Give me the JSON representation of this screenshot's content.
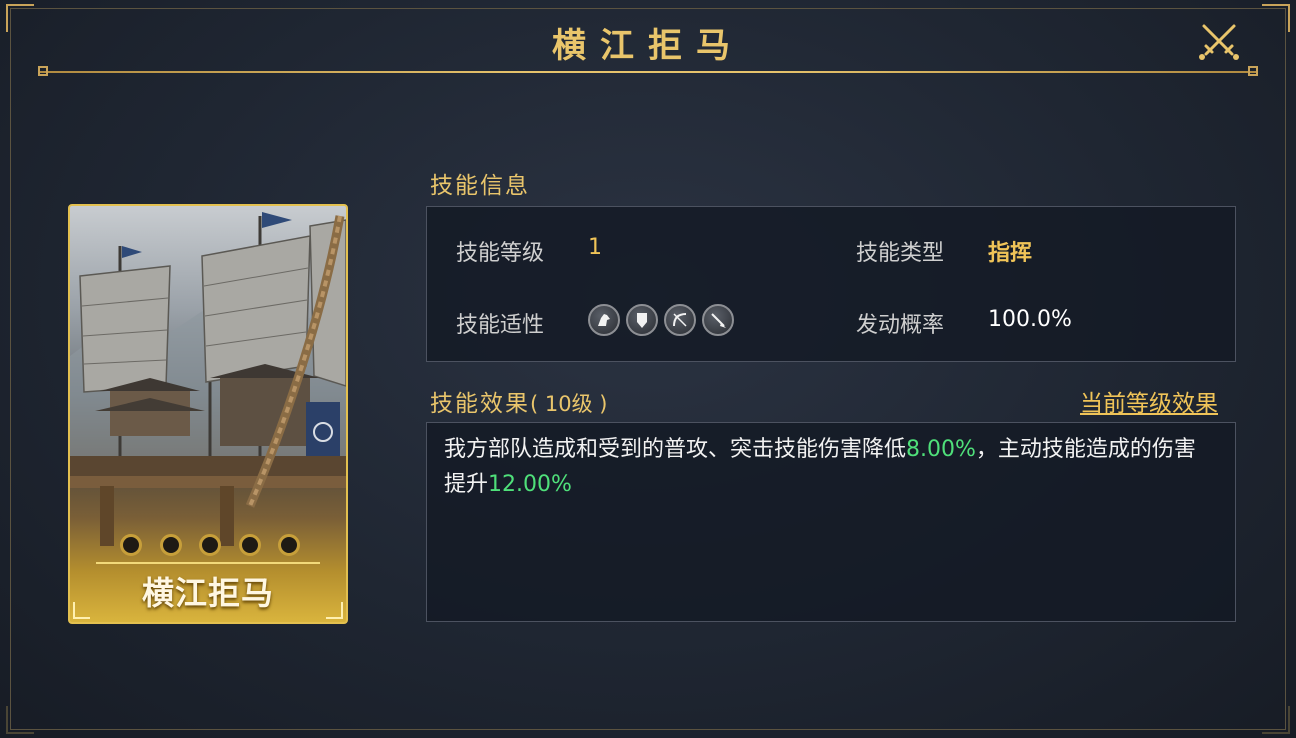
{
  "header": {
    "title": "横江拒马"
  },
  "card": {
    "name": "横江拒马"
  },
  "skill_info": {
    "section_title": "技能信息",
    "level_label": "技能等级",
    "level_value": "1",
    "type_label": "技能类型",
    "type_value": "指挥",
    "aptitude_label": "技能适性",
    "aptitude_icons": [
      "cavalry-icon",
      "shield-icon",
      "bow-icon",
      "spear-icon"
    ],
    "chance_label": "发动概率",
    "chance_value": "100.0%"
  },
  "skill_effect": {
    "section_title": "技能效果",
    "level_note": "( 10级 )",
    "current_level_link": "当前等级效果",
    "text_part1": "我方部队造成和受到的普攻、突击技能伤害降低",
    "value1": "8.00%",
    "text_part2": "，主动技能造成的伤害提升",
    "value2": "12.00%"
  },
  "colors": {
    "gold": "#e9c56b",
    "green": "#4fe07a",
    "panel": "#141a24"
  }
}
